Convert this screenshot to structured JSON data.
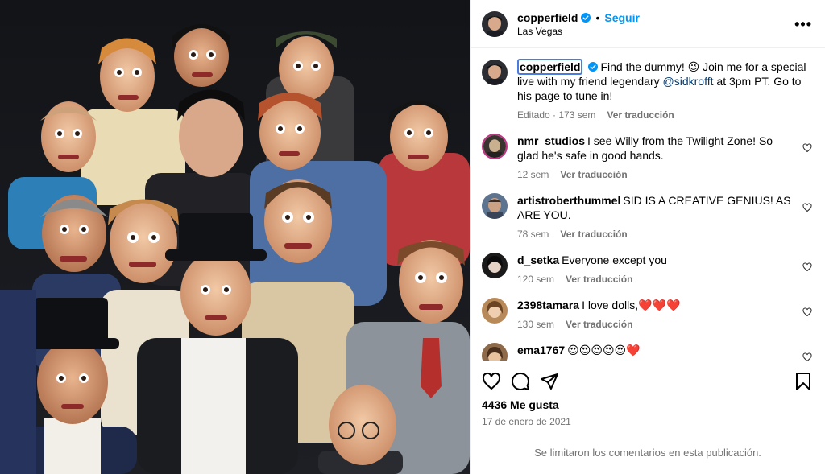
{
  "post": {
    "author": "copperfield",
    "follow_label": "Seguir",
    "separator": "•",
    "location": "Las Vegas",
    "more_label": "•••",
    "colors": {
      "follow": "#0095f6",
      "verified": "#0095f6",
      "meta": "#737373"
    }
  },
  "caption": {
    "user": "copperfield",
    "text_before": "Find the dummy! 😉 Join me for a special live with my friend legendary ",
    "mention": "@sidkrofft",
    "text_after": " at 3pm PT. Go to his page to tune in!",
    "meta_edited": "Editado · 173 sem",
    "translate": "Ver traducción"
  },
  "comments": [
    {
      "user": "nmr_studios",
      "text": "I see Willy from the Twilight Zone! So glad he's safe in good hands.",
      "time": "12 sem",
      "translate": "Ver traducción",
      "avatar_icon": "user-avatar-icon"
    },
    {
      "user": "artistroberthummel",
      "text": "SID IS A CREATIVE GENIUS! AS ARE YOU.",
      "time": "78 sem",
      "translate": "Ver traducción",
      "avatar_icon": "user-avatar-icon"
    },
    {
      "user": "d_setka",
      "text": "Everyone except you",
      "time": "120 sem",
      "translate": "Ver traducción",
      "avatar_icon": "user-avatar-icon"
    },
    {
      "user": "2398tamara",
      "text": "I love dolls,❤️❤️❤️",
      "time": "130 sem",
      "translate": "Ver traducción",
      "avatar_icon": "user-avatar-icon"
    },
    {
      "user": "ema1767",
      "text": "😍😍😍😍😍❤️",
      "time": "",
      "translate": "",
      "avatar_icon": "user-avatar-icon"
    }
  ],
  "actions": {
    "likes": "4436 Me gusta",
    "date": "17 de enero de 2021",
    "icons": [
      "heart-icon",
      "comment-icon",
      "share-icon",
      "bookmark-icon"
    ]
  },
  "footer": {
    "notice": "Se limitaron los comentarios en esta publicación."
  }
}
